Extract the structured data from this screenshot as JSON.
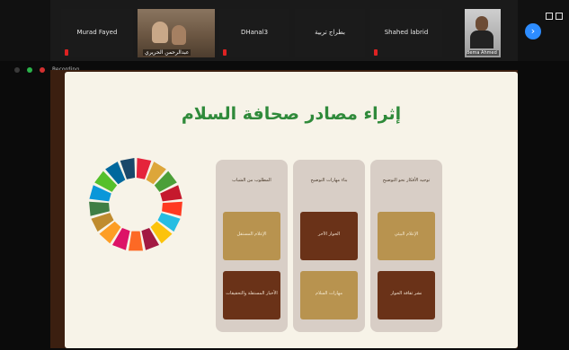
{
  "participants": [
    {
      "name": "Murad Fayed",
      "muted": true
    },
    {
      "name": "عبدالرحمن الحريري",
      "video": true
    },
    {
      "name": "DHanal3",
      "muted": true
    },
    {
      "name": "بطراج تربية",
      "muted": false
    },
    {
      "name": "Shahed labrid",
      "muted": true
    },
    {
      "name": "Bema Ahmed",
      "video": true
    }
  ],
  "indicator": {
    "recording_label": "Recording..."
  },
  "slide": {
    "title": "إثراء مصادر صحافة السلام",
    "columns": [
      {
        "header": "المطلوب من الشباب",
        "cards": [
          {
            "label": "الإعلام المستقل",
            "tone": "light"
          },
          {
            "label": "الأخبار المستقلة والتحقيقات",
            "tone": "dark"
          }
        ]
      },
      {
        "header": "بناء مهارات التوضيح",
        "cards": [
          {
            "label": "الحوار الآخر",
            "tone": "dark"
          },
          {
            "label": "مهارات السلام",
            "tone": "light"
          }
        ]
      },
      {
        "header": "توجيه الأفكار نحو التوضيح",
        "cards": [
          {
            "label": "الإعلام البيئي",
            "tone": "light"
          },
          {
            "label": "نشر ثقافة الحوار",
            "tone": "dark"
          }
        ]
      }
    ]
  },
  "icons": {
    "next_page": "chevron-right-icon",
    "view_toggle": "grid-view-icon"
  },
  "colors": {
    "title_green": "#2f8a3a",
    "card_light": "#b8934f",
    "card_dark": "#6a3218",
    "accent_blue": "#2d8cff"
  }
}
